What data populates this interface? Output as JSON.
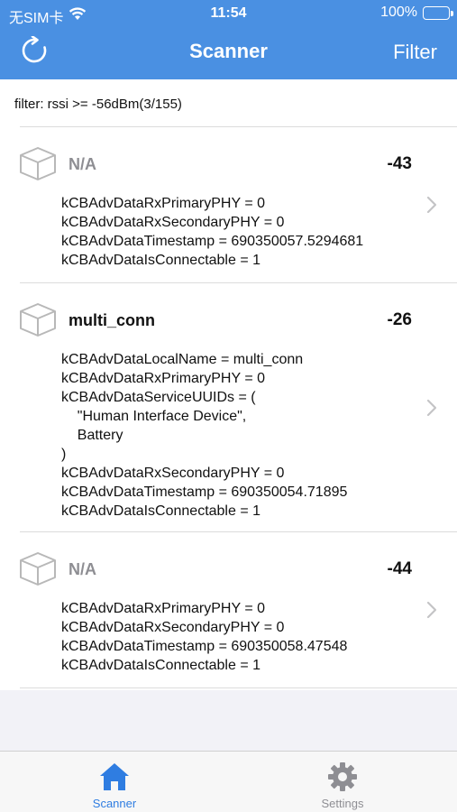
{
  "status_bar": {
    "carrier": "无SIM卡",
    "time": "11:54",
    "battery_percent": "100%",
    "battery_level": 1.0
  },
  "nav": {
    "title": "Scanner",
    "filter_label": "Filter",
    "refresh_icon": "refresh-icon"
  },
  "filter_summary": "filter: rssi >= -56dBm(3/155)",
  "devices": [
    {
      "name": "N/A",
      "rssi": "-43",
      "adv": "kCBAdvDataRxPrimaryPHY = 0\nkCBAdvDataRxSecondaryPHY = 0\nkCBAdvDataTimestamp = 690350057.5294681\nkCBAdvDataIsConnectable = 1"
    },
    {
      "name": "multi_conn",
      "rssi": "-26",
      "adv": "kCBAdvDataLocalName = multi_conn\nkCBAdvDataRxPrimaryPHY = 0\nkCBAdvDataServiceUUIDs = (\n    \"Human Interface Device\",\n    Battery\n)\nkCBAdvDataRxSecondaryPHY = 0\nkCBAdvDataTimestamp = 690350054.71895\nkCBAdvDataIsConnectable = 1"
    },
    {
      "name": "N/A",
      "rssi": "-44",
      "adv": "kCBAdvDataRxPrimaryPHY = 0\nkCBAdvDataRxSecondaryPHY = 0\nkCBAdvDataTimestamp = 690350058.47548\nkCBAdvDataIsConnectable = 1"
    }
  ],
  "tabs": [
    {
      "label": "Scanner",
      "icon": "home-icon",
      "active": true
    },
    {
      "label": "Settings",
      "icon": "gear-icon",
      "active": false
    }
  ],
  "colors": {
    "accent": "#4a90e2",
    "tab_active": "#2f7de1",
    "tab_inactive": "#8e8e93",
    "battery": "#34c759"
  }
}
